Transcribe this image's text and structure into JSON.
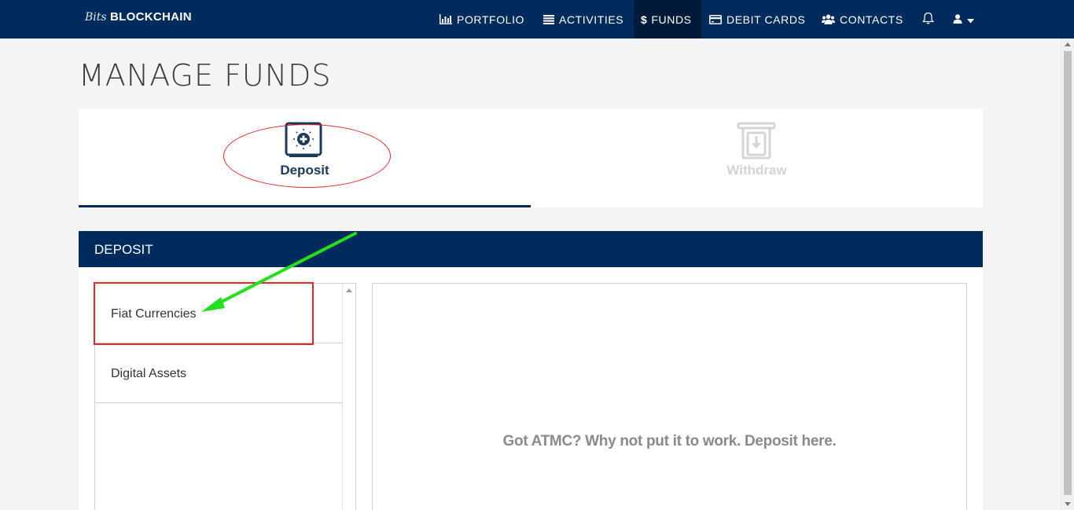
{
  "nav": {
    "brand_script": "Bits",
    "brand_word": "BLOCKCHAIN",
    "items": [
      {
        "label": "PORTFOLIO",
        "icon": "bar-chart-icon"
      },
      {
        "label": "ACTIVITIES",
        "icon": "list-icon"
      },
      {
        "label": "FUNDS",
        "icon": "dollar-icon",
        "active": true
      },
      {
        "label": "DEBIT CARDS",
        "icon": "credit-card-icon"
      },
      {
        "label": "CONTACTS",
        "icon": "users-icon"
      }
    ],
    "bell_icon": "bell-icon",
    "user_icon": "user-icon"
  },
  "page": {
    "title": "MANAGE FUNDS"
  },
  "tabs": {
    "deposit": {
      "label": "Deposit",
      "icon": "deposit-safe-icon",
      "active": true
    },
    "withdraw": {
      "label": "Withdraw",
      "icon": "withdraw-atm-icon",
      "active": false
    }
  },
  "deposit_panel": {
    "heading": "DEPOSIT",
    "options": [
      "Fiat Currencies",
      "Digital Assets"
    ],
    "message": "Got ATMC? Why not put it to work. Deposit here."
  },
  "colors": {
    "navbar": "#002b5c",
    "active_nav": "#001a3a",
    "annotation_red": "#e32626",
    "annotation_green": "#22e01a"
  }
}
